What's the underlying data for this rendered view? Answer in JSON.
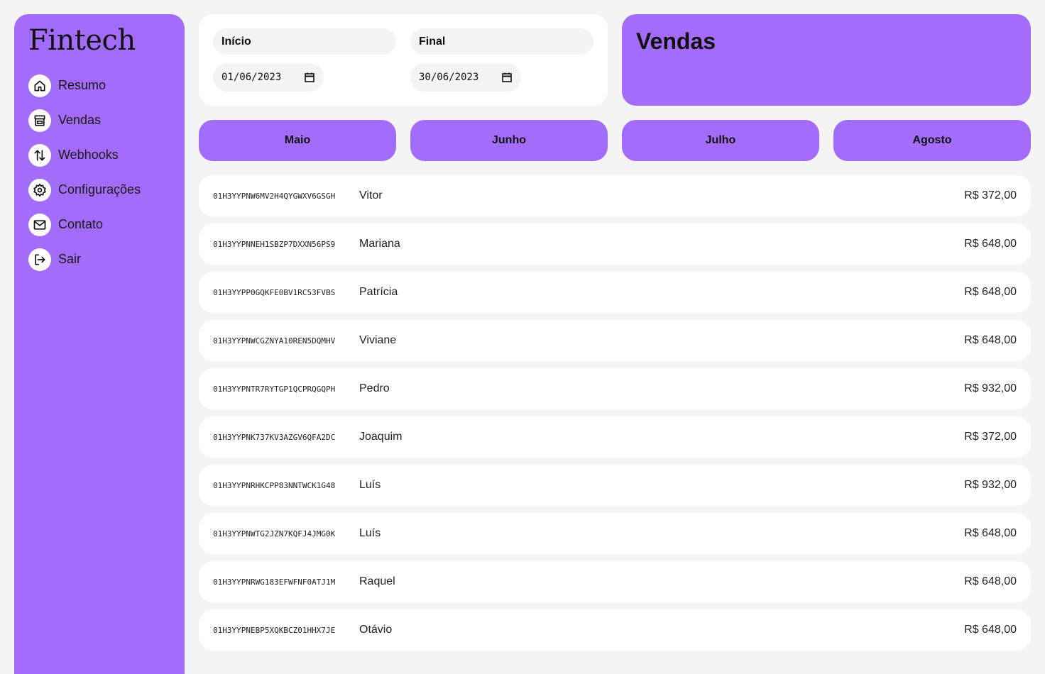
{
  "sidebar": {
    "logo": "Fintech",
    "items": [
      {
        "label": "Resumo",
        "icon": "home-icon"
      },
      {
        "label": "Vendas",
        "icon": "store-icon"
      },
      {
        "label": "Webhooks",
        "icon": "arrows-up-down-icon"
      },
      {
        "label": "Configurações",
        "icon": "gear-icon"
      },
      {
        "label": "Contato",
        "icon": "mail-icon"
      },
      {
        "label": "Sair",
        "icon": "logout-icon"
      }
    ]
  },
  "filters": {
    "start_label": "Início",
    "start_value": "01/06/2023",
    "end_label": "Final",
    "end_value": "30/06/2023"
  },
  "header": {
    "title": "Vendas"
  },
  "months": [
    "Maio",
    "Junho",
    "Julho",
    "Agosto"
  ],
  "sales": [
    {
      "id": "01H3YYPNW6MV2H4QYGWXV6GSGH",
      "name": "Vitor",
      "value": "R$ 372,00"
    },
    {
      "id": "01H3YYPNNEH1SBZP7DXXN56PS9",
      "name": "Mariana",
      "value": "R$ 648,00"
    },
    {
      "id": "01H3YYPP0GQKFE0BV1RC53FVBS",
      "name": "Patrícia",
      "value": "R$ 648,00"
    },
    {
      "id": "01H3YYPNWCGZNYA10REN5DQMHV",
      "name": "Viviane",
      "value": "R$ 648,00"
    },
    {
      "id": "01H3YYPNTR7RYTGP1QCPRQGQPH",
      "name": "Pedro",
      "value": "R$ 932,00"
    },
    {
      "id": "01H3YYPNK737KV3AZGV6QFA2DC",
      "name": "Joaquim",
      "value": "R$ 372,00"
    },
    {
      "id": "01H3YYPNRHKCPP83NNTWCK1G48",
      "name": "Luís",
      "value": "R$ 932,00"
    },
    {
      "id": "01H3YYPNWTG2JZN7KQFJ4JMG0K",
      "name": "Luís",
      "value": "R$ 648,00"
    },
    {
      "id": "01H3YYPNRWG183EFWFNF0ATJ1M",
      "name": "Raquel",
      "value": "R$ 648,00"
    },
    {
      "id": "01H3YYPNEBP5XQKBCZ01HHX7JE",
      "name": "Otávio",
      "value": "R$ 648,00"
    }
  ],
  "colors": {
    "accent": "#a36cfb",
    "background": "#f4f4f4",
    "card": "#ffffff"
  }
}
